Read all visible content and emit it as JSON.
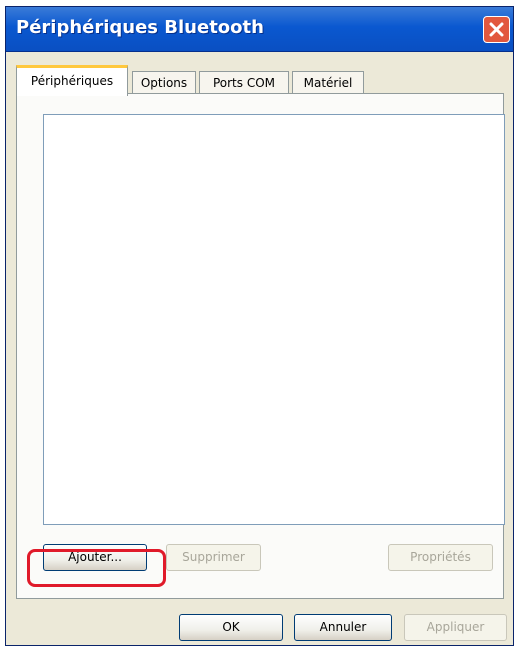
{
  "window": {
    "title": "Périphériques Bluetooth"
  },
  "tabs": [
    {
      "label": "Périphériques",
      "active": true
    },
    {
      "label": "Options",
      "active": false
    },
    {
      "label": "Ports COM",
      "active": false
    },
    {
      "label": "Matériel",
      "active": false
    }
  ],
  "device_list": {
    "items": []
  },
  "panel_buttons": {
    "add_label": "Ajouter...",
    "remove_label": "Supprimer",
    "properties_label": "Propriétés"
  },
  "dialog_buttons": {
    "ok_label": "OK",
    "cancel_label": "Annuler",
    "apply_label": "Appliquer"
  },
  "colors": {
    "titlebar": "#0a58d0",
    "highlight": "#e01a2a",
    "active_tab_accent": "#ffc83d"
  },
  "icons": {
    "close": "close-icon"
  }
}
